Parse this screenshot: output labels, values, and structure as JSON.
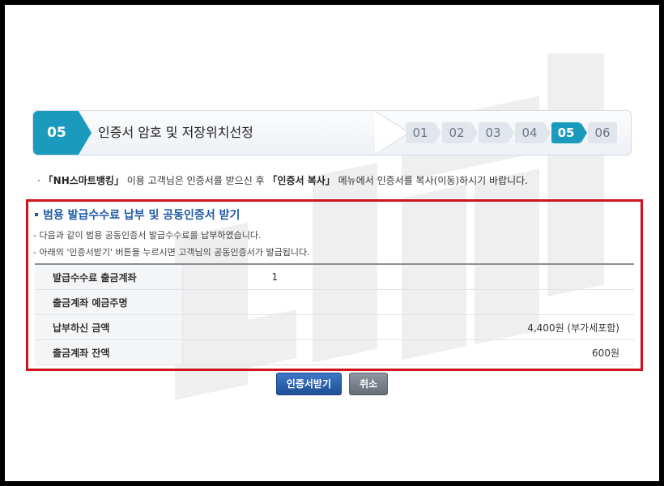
{
  "step": {
    "current_number": "05",
    "title": "인증서 암호 및 저장위치선정",
    "steps": [
      "01",
      "02",
      "03",
      "04",
      "05",
      "06"
    ],
    "active_step": "05",
    "accent_color": "#1a9bbd"
  },
  "notice": {
    "bullet": "·",
    "prefix": "「NH스마트뱅킹」",
    "middle": " 이용 고객님은 인증서를 받으신 후 ",
    "menu": "「인증서 복사」",
    "suffix": " 메뉴에서 인증서를 복사(이동)하시기 바랍니다."
  },
  "panel": {
    "border_color": "#d0141c",
    "title": "범용 발급수수료 납부 및 공동인증서 받기",
    "desc1": "- 다음과 같이 범용 공동인증서 발급수수료를 납부하였습니다.",
    "desc2": "- 아래의 '인증서받기' 버튼을 누르시면 고객님의 공동인증서가 발급됩니다.",
    "rows": [
      {
        "label": "발급수수료 출금계좌",
        "value": "1"
      },
      {
        "label": "출금계좌 예금주명",
        "value": ""
      },
      {
        "label": "납부하신 금액",
        "value": "4,400원 (부가세포함)"
      },
      {
        "label": "출금계좌 잔액",
        "value": "600원"
      }
    ]
  },
  "buttons": {
    "receive": "인증서받기",
    "cancel": "취소"
  }
}
